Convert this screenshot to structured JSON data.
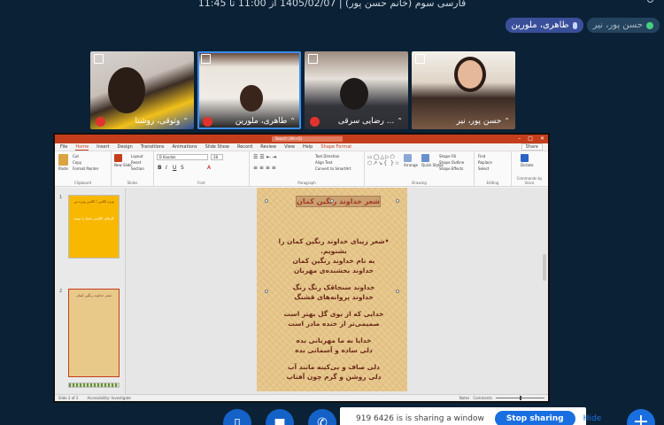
{
  "meeting": {
    "title": "فارسی سوم (خانم حسن پور) | 1405/02/07 از 11:00 تا 11:45"
  },
  "speakers": {
    "active_speaker": "طاهری، ملورین",
    "host": "حسن پور، نیر"
  },
  "participants": [
    {
      "name": "وثوقی، روشنا",
      "muted": true
    },
    {
      "name": "طاهری، ملورین",
      "muted": true,
      "active": true
    },
    {
      "name": "رضایی سرقی ...",
      "muted": true
    },
    {
      "name": "حسن پور، نیر",
      "muted": false
    }
  ],
  "powerpoint": {
    "window_title": "Presentation - PowerPoint",
    "search_placeholder": "Search (Alt+Q)",
    "tabs": [
      "File",
      "Home",
      "Insert",
      "Design",
      "Transitions",
      "Animations",
      "Slide Show",
      "Record",
      "Review",
      "View",
      "Help",
      "Shape Format"
    ],
    "share_label": "Share",
    "groups": [
      "Clipboard",
      "Slides",
      "Font",
      "Paragraph",
      "Drawing",
      "Editing",
      "Commands by Voice"
    ],
    "font_name": "B Koodak",
    "font_size": "28",
    "buttons": {
      "paste": "Paste",
      "cut": "Cut",
      "copy": "Copy",
      "format_painter": "Format Painter",
      "new_slide": "New Slide",
      "layout": "Layout",
      "reset": "Reset",
      "section": "Section",
      "text_direction": "Text Direction",
      "align_text": "Align Text",
      "convert_smartart": "Convert to SmartArt",
      "arrange": "Arrange",
      "quick_styles": "Quick Styles",
      "shape_fill": "Shape Fill",
      "shape_outline": "Shape Outline",
      "shape_effects": "Shape Effects",
      "find": "Find",
      "replace": "Replace",
      "select": "Select",
      "dictate": "Dictate"
    },
    "thumbnails": {
      "slide1_number": "1",
      "slide1_title": "ویژه کلاس / کلاس ویژه نیر",
      "slide1_text": "کارهای کلاسی شما را ببینید",
      "slide2_number": "2",
      "slide2_title": "شعر خداوند رنگین کمان"
    },
    "slide": {
      "title": "شعر خداوند رنگین کمان",
      "stanzas": [
        [
          "•شعر زیبای خداوند رنگین کمان را بشنویم.",
          "به نام خداوند رنگین کمان",
          "خداوند بخشنده‌ی مهربان"
        ],
        [
          "خداوند سنجاقک رنگ رنگ",
          "خداوند پروانه‌های قشنگ"
        ],
        [
          "خدایی که از بوی گل بهتر است",
          "صمیمی‌تر از خنده مادر است"
        ],
        [
          "خدایا به ما مهربانی بده",
          "دلی ساده و آسمانی بده"
        ],
        [
          "دلی صاف و بی‌کینه مانند آب",
          "دلی روشن و گرم چون آفتاب"
        ]
      ]
    },
    "status": {
      "slide_of": "Slide 2 of 2",
      "accessibility": "Accessibility: Investigate",
      "notes": "Notes",
      "comments": "Comments"
    }
  },
  "share_notice": {
    "text": "919 6426 is is sharing a window",
    "stop_label": "Stop sharing",
    "hide_label": "Hide"
  },
  "colors": {
    "background": "#0b2236",
    "accent": "#1a6fe0",
    "ppt_red": "#c43e1c",
    "mute_red": "#e0332e"
  }
}
